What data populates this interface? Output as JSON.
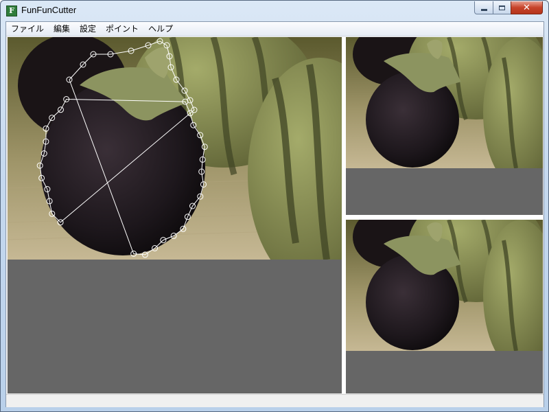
{
  "window": {
    "title": "FunFunCutter",
    "icon_letter": "F",
    "icon": "app-icon",
    "controls": [
      "minimize-icon",
      "maximize-icon",
      "close-icon"
    ]
  },
  "menu": {
    "items": [
      {
        "label": "ファイル"
      },
      {
        "label": "編集"
      },
      {
        "label": "設定"
      },
      {
        "label": "ポイント"
      },
      {
        "label": "ヘルプ"
      }
    ]
  },
  "panes": {
    "main": {
      "background": "#666666",
      "content": "photo-of-eggplant-with-selection-path"
    },
    "preview_top": {
      "background": "#666666",
      "content": "photo-of-eggplant"
    },
    "preview_bottom": {
      "background": "#666666",
      "content": "photo-of-eggplant"
    }
  },
  "colors": {
    "pane_background": "#666666",
    "separator": "#ffffff",
    "selection_path": "#ffffff"
  }
}
